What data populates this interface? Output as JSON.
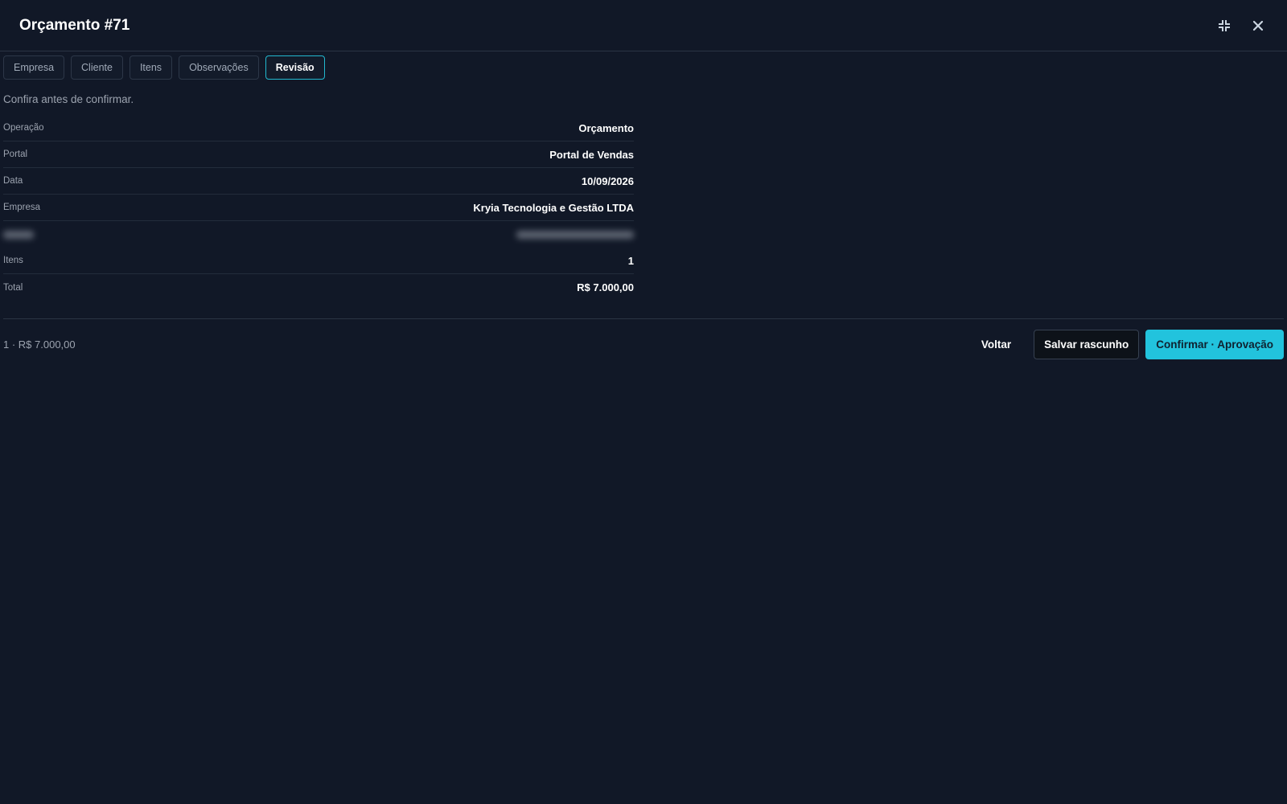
{
  "header": {
    "title": "Orçamento #71",
    "minimize_icon": "collapse-icon",
    "close_icon": "close-icon"
  },
  "tabs": [
    {
      "label": "Empresa",
      "active": false
    },
    {
      "label": "Cliente",
      "active": false
    },
    {
      "label": "Itens",
      "active": false
    },
    {
      "label": "Observações",
      "active": false
    },
    {
      "label": "Revisão",
      "active": true
    }
  ],
  "hint": "Confira antes de confirmar.",
  "summary": {
    "rows": [
      {
        "label": "Operação",
        "value": "Orçamento"
      },
      {
        "label": "Portal",
        "value": "Portal de Vendas"
      },
      {
        "label": "Data",
        "value": "10/09/2026"
      },
      {
        "label": "Empresa",
        "value": "Kryia Tecnologia e Gestão LTDA"
      },
      {
        "label": "",
        "value": "",
        "redacted": true
      },
      {
        "label": "Itens",
        "value": "1"
      },
      {
        "label": "Total",
        "value": "R$ 7.000,00"
      }
    ]
  },
  "footer": {
    "summary": "1 · R$ 7.000,00",
    "back_label": "Voltar",
    "save_draft_label": "Salvar rascunho",
    "confirm_label": "Confirmar · Aprovação"
  },
  "colors": {
    "background": "#111827",
    "accent": "#22c3dd",
    "border": "#2a3444"
  }
}
